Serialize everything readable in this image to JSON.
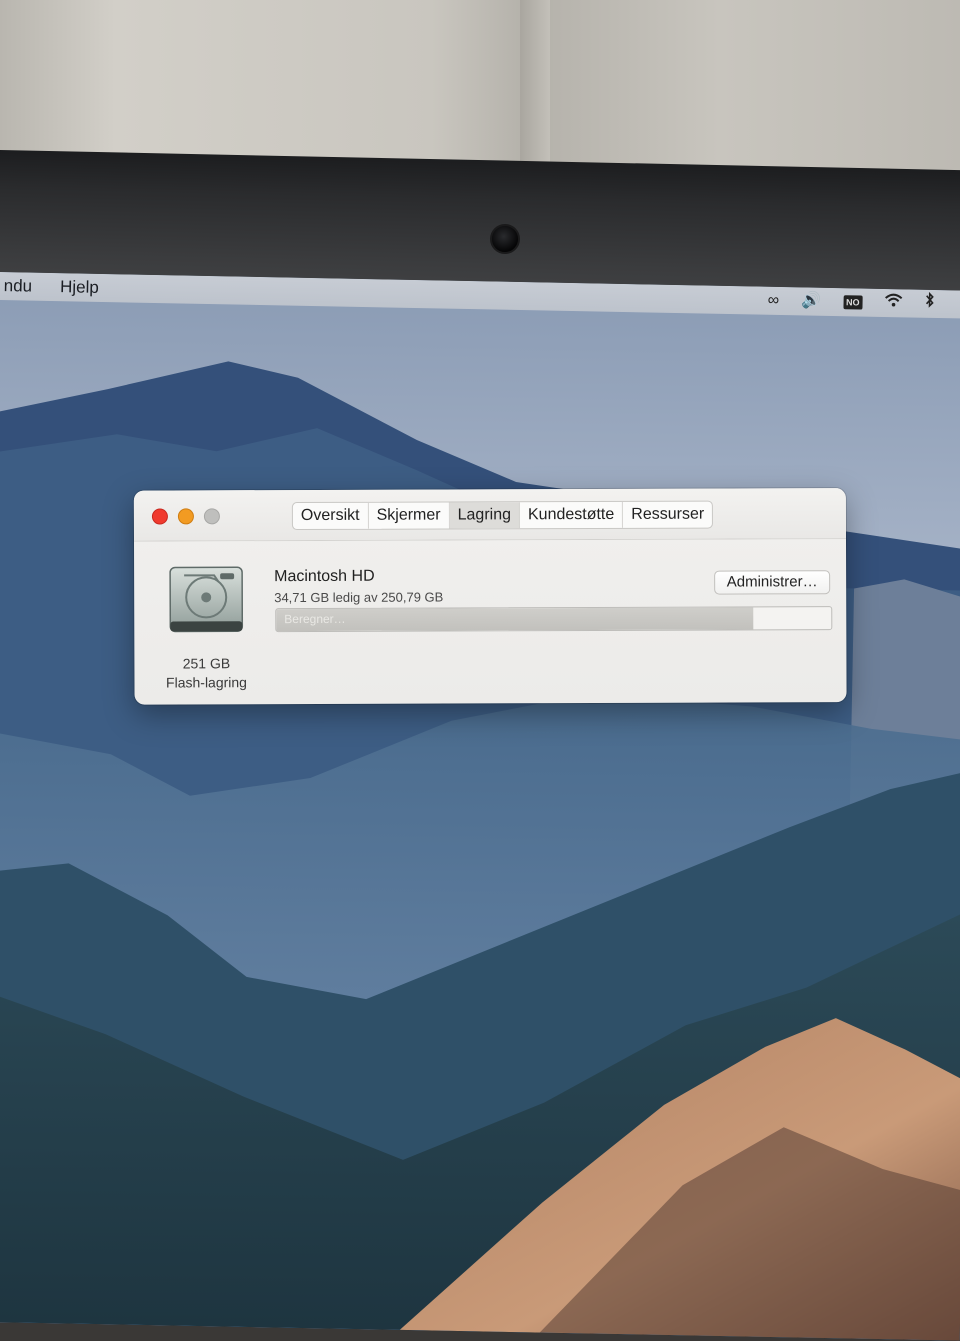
{
  "menubar": {
    "items": [
      "ndu",
      "Hjelp"
    ],
    "status_icons": [
      "creative-cloud-icon",
      "volume-icon",
      "input-source-icon",
      "wifi-icon",
      "bluetooth-icon"
    ],
    "input_source_label": "NO"
  },
  "window": {
    "tabs": [
      {
        "label": "Oversikt",
        "active": false
      },
      {
        "label": "Skjermer",
        "active": false
      },
      {
        "label": "Lagring",
        "active": true
      },
      {
        "label": "Kundestøtte",
        "active": false
      },
      {
        "label": "Ressurser",
        "active": false
      }
    ],
    "disk": {
      "name": "Macintosh HD",
      "free_text": "34,71 GB ledig av 250,79 GB",
      "size": "251 GB",
      "type": "Flash-lagring",
      "status_text": "Beregner…",
      "used_fraction": 0.86
    },
    "manage_label": "Administrer…"
  },
  "colors": {
    "close": "#f03a2e",
    "minimize": "#f29b22",
    "zoom": "#bfbfbd"
  }
}
